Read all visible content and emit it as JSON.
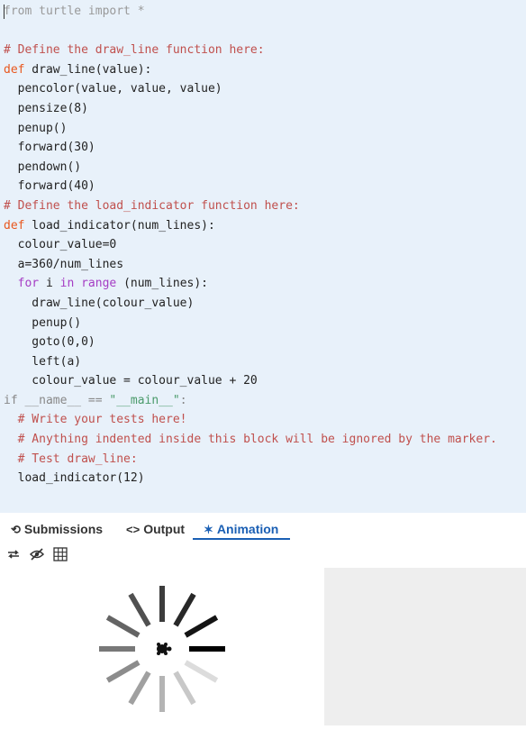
{
  "editor": {
    "lines": [
      [
        {
          "t": "from turtle import *",
          "c": "#999999"
        }
      ],
      [
        {
          "t": "",
          "c": "#222"
        }
      ],
      [
        {
          "t": "# Define the draw_line function here:",
          "c": "#c0504d"
        }
      ],
      [
        {
          "t": "def",
          "c": "#e8571e"
        },
        {
          "t": " draw_line(value):",
          "c": "#222"
        }
      ],
      [
        {
          "t": "  pencolor(value, value, value)",
          "c": "#222"
        }
      ],
      [
        {
          "t": "  pensize(8)",
          "c": "#222"
        }
      ],
      [
        {
          "t": "  penup()",
          "c": "#222"
        }
      ],
      [
        {
          "t": "  forward(30)",
          "c": "#222"
        }
      ],
      [
        {
          "t": "  pendown()",
          "c": "#222"
        }
      ],
      [
        {
          "t": "  forward(40)",
          "c": "#222"
        }
      ],
      [
        {
          "t": "# Define the load_indicator function here:",
          "c": "#c0504d"
        }
      ],
      [
        {
          "t": "def",
          "c": "#e8571e"
        },
        {
          "t": " load_indicator(num_lines):",
          "c": "#222"
        }
      ],
      [
        {
          "t": "  colour_value=0",
          "c": "#222"
        }
      ],
      [
        {
          "t": "  a=360/num_lines",
          "c": "#222"
        }
      ],
      [
        {
          "t": "  ",
          "c": "#222"
        },
        {
          "t": "for",
          "c": "#a53dc4"
        },
        {
          "t": " i ",
          "c": "#222"
        },
        {
          "t": "in",
          "c": "#a53dc4"
        },
        {
          "t": " ",
          "c": "#222"
        },
        {
          "t": "range",
          "c": "#a53dc4"
        },
        {
          "t": " (num_lines):",
          "c": "#222"
        }
      ],
      [
        {
          "t": "    draw_line(colour_value)",
          "c": "#222"
        }
      ],
      [
        {
          "t": "    penup()",
          "c": "#222"
        }
      ],
      [
        {
          "t": "    goto(0,0)",
          "c": "#222"
        }
      ],
      [
        {
          "t": "    left(a)",
          "c": "#222"
        }
      ],
      [
        {
          "t": "    colour_value = colour_value + 20",
          "c": "#222"
        }
      ],
      [
        {
          "t": "if __name__ == ",
          "c": "#888888"
        },
        {
          "t": "\"__main__\"",
          "c": "#4a9a6a"
        },
        {
          "t": ":",
          "c": "#888888"
        }
      ],
      [
        {
          "t": "  # Write your tests here!",
          "c": "#c0504d"
        }
      ],
      [
        {
          "t": "  # Anything indented inside this block will be ignored by the marker.",
          "c": "#c0504d"
        }
      ],
      [
        {
          "t": "  # Test draw_line:",
          "c": "#c0504d"
        }
      ],
      [
        {
          "t": "  load_indicator(12)",
          "c": "#222"
        }
      ]
    ]
  },
  "tabs": {
    "submissions": {
      "icon": "⟲",
      "label": "Submissions"
    },
    "output": {
      "icon": "<>",
      "label": "Output"
    },
    "animation": {
      "icon": "✶",
      "label": "Animation"
    }
  },
  "toolbar": {
    "repeat_icon": "repeat-icon",
    "hide_icon": "eye-off-icon",
    "grid_icon": "grid-icon"
  },
  "turtle": {
    "num_lines": 12,
    "colour_step": 20,
    "line_colors": [
      "#000000",
      "#141414",
      "#282828",
      "#3c3c3c",
      "#505050",
      "#646464",
      "#787878",
      "#8c8c8c",
      "#a0a0a0",
      "#b4b4b4",
      "#c8c8c8",
      "#dcdcdc"
    ]
  },
  "colors": {
    "editor_bg": "#e8f1fa",
    "active_tab": "#1a5fb4",
    "side_panel": "#eeeeee"
  }
}
